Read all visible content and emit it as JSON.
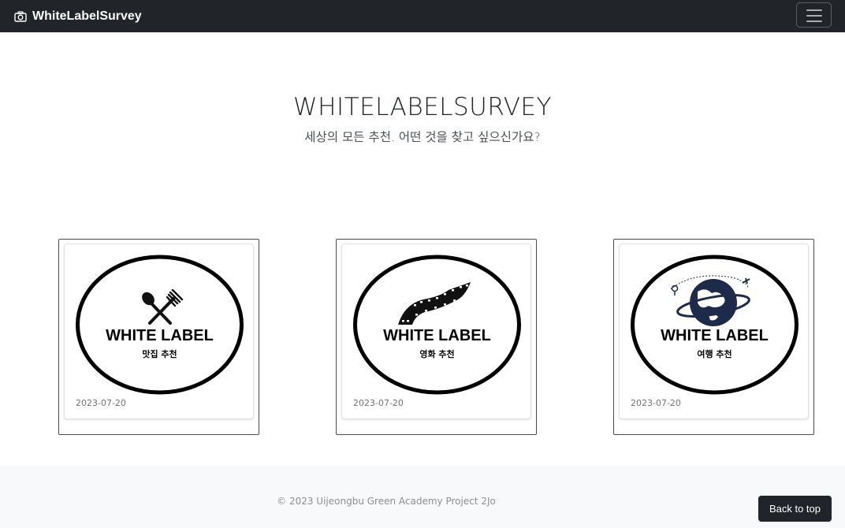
{
  "navbar": {
    "brand": "WhiteLabelSurvey",
    "brand_icon": "camera-icon",
    "toggler_icon": "hamburger-icon",
    "bg_color": "#212529"
  },
  "hero": {
    "title": "WHITELABELSURVEY",
    "subtitle": "세상의 모든 추천. 어떤 것을 찾고 싶으신가요?"
  },
  "cards": [
    {
      "logo_text": "WHITE LABEL",
      "logo_sub": "맛집 추천",
      "logo_icon": "fork-spoon-icon",
      "date": "2023-07-20"
    },
    {
      "logo_text": "WHITE LABEL",
      "logo_sub": "영화 추천",
      "logo_icon": "film-strip-icon",
      "date": "2023-07-20"
    },
    {
      "logo_text": "WHITE LABEL",
      "logo_sub": "여행 추천",
      "logo_icon": "globe-plane-icon",
      "date": "2023-07-20"
    }
  ],
  "footer": {
    "copyright": "© 2023 Uijeongbu Green Academy Project 2Jo",
    "back_to_top": "Back to top"
  }
}
